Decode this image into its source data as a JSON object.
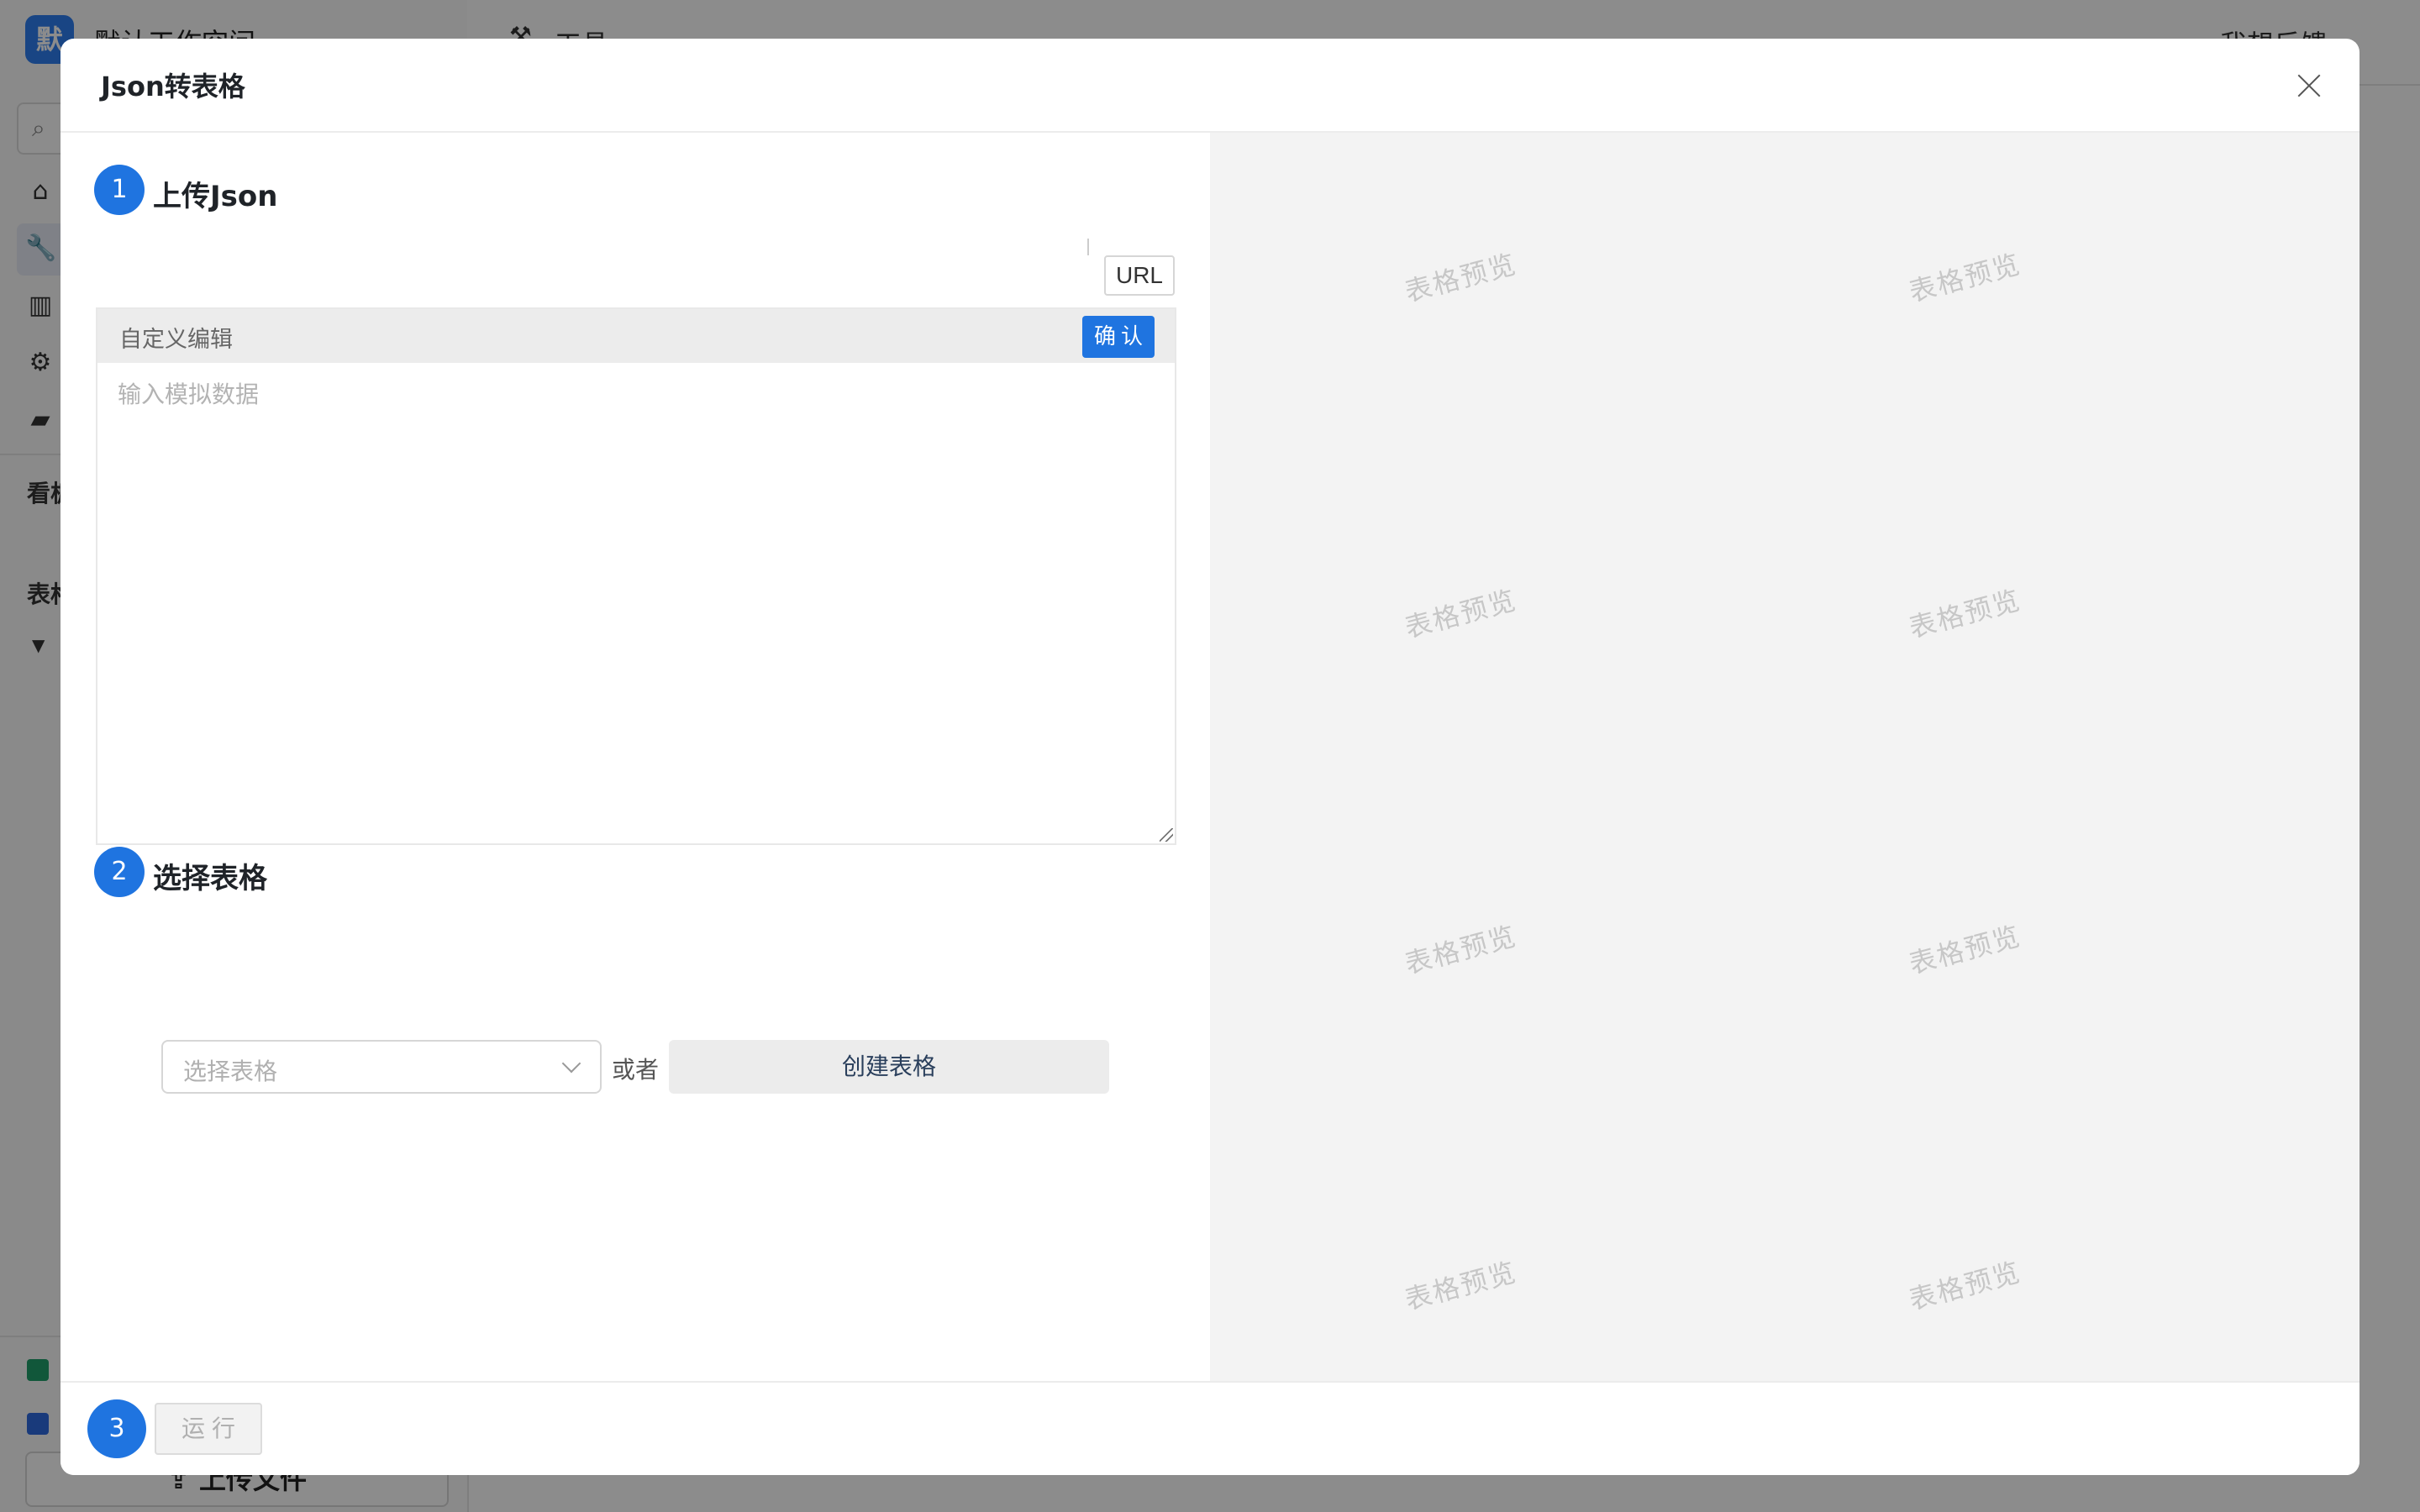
{
  "app": {
    "workspace_logo": "默",
    "workspace_name": "默认工作空间",
    "header_title": "工具",
    "header_feedback": "我想反馈",
    "sidebar_section_board": "看板",
    "sidebar_section_table": "表格",
    "upload_button": "上传文件"
  },
  "modal": {
    "title": "Json转表格",
    "step1": {
      "number": "1",
      "title": "上传Json"
    },
    "url_button": "URL",
    "editor": {
      "label": "自定义编辑",
      "confirm": "确认",
      "placeholder": "输入模拟数据"
    },
    "step2": {
      "number": "2",
      "title": "选择表格"
    },
    "select_placeholder": "选择表格",
    "or_text": "或者",
    "create_button": "创建表格",
    "step3": {
      "number": "3"
    },
    "run_button": "运行",
    "preview_watermark": "表格预览"
  }
}
